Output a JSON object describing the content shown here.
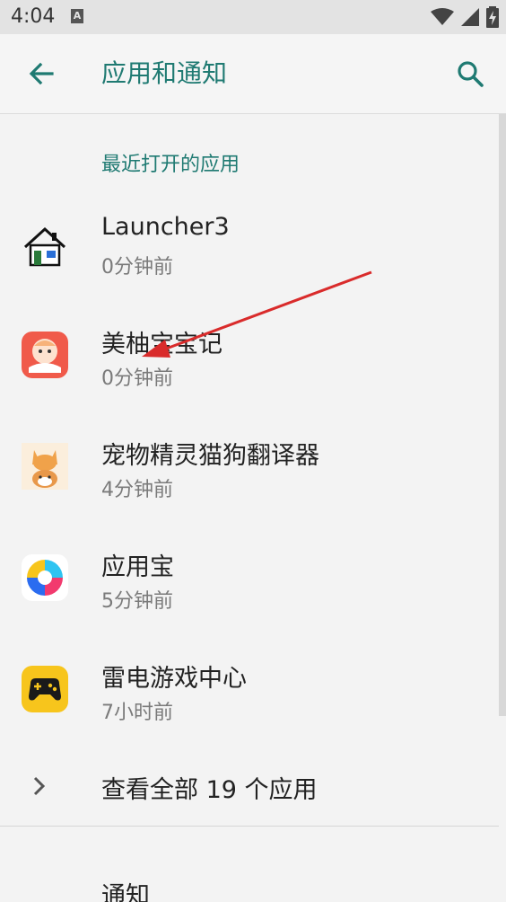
{
  "status_bar": {
    "time": "4:04",
    "a_icon_letter": "A"
  },
  "app_bar": {
    "title": "应用和通知",
    "back_icon": "arrow-left-icon",
    "search_icon": "search-icon",
    "accent_color": "#1f7a72"
  },
  "recent": {
    "header": "最近打开的应用",
    "apps": [
      {
        "name": "Launcher3",
        "time": "0分钟前",
        "icon": "house-icon"
      },
      {
        "name": "美柚宝宝记",
        "time": "0分钟前",
        "icon": "baby-face-icon"
      },
      {
        "name": "宠物精灵猫狗翻译器",
        "time": "4分钟前",
        "icon": "cat-dog-icon"
      },
      {
        "name": "应用宝",
        "time": "5分钟前",
        "icon": "yingyongbao-icon"
      },
      {
        "name": "雷电游戏中心",
        "time": "7小时前",
        "icon": "gamepad-icon"
      }
    ]
  },
  "see_all": {
    "label": "查看全部 19 个应用"
  },
  "notification": {
    "label": "通知"
  }
}
